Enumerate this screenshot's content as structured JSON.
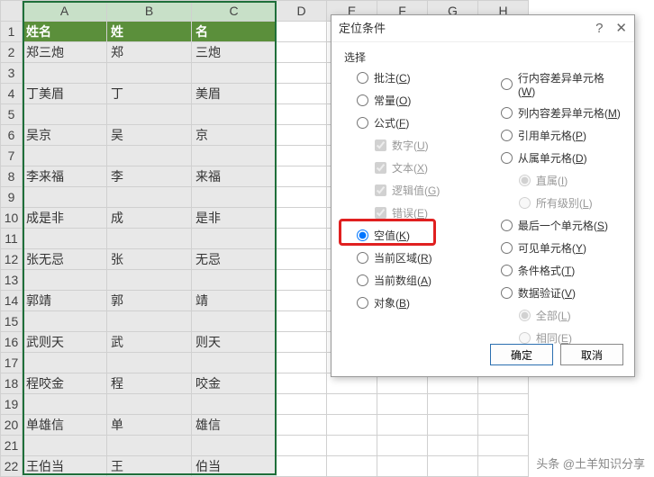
{
  "columns": [
    "A",
    "B",
    "C",
    "D",
    "E",
    "F",
    "G",
    "H"
  ],
  "rows_count": 22,
  "headers": {
    "A": "姓名",
    "B": "姓",
    "C": "名"
  },
  "data_rows": [
    {
      "A": "郑三炮",
      "B": "郑",
      "C": "三炮"
    },
    {
      "A": "",
      "B": "",
      "C": ""
    },
    {
      "A": "丁美眉",
      "B": "丁",
      "C": "美眉"
    },
    {
      "A": "",
      "B": "",
      "C": ""
    },
    {
      "A": "吴京",
      "B": "吴",
      "C": "京"
    },
    {
      "A": "",
      "B": "",
      "C": ""
    },
    {
      "A": "李来福",
      "B": "李",
      "C": "来福"
    },
    {
      "A": "",
      "B": "",
      "C": ""
    },
    {
      "A": "成是非",
      "B": "成",
      "C": "是非"
    },
    {
      "A": "",
      "B": "",
      "C": ""
    },
    {
      "A": "张无忌",
      "B": "张",
      "C": "无忌"
    },
    {
      "A": "",
      "B": "",
      "C": ""
    },
    {
      "A": "郭靖",
      "B": "郭",
      "C": "靖"
    },
    {
      "A": "",
      "B": "",
      "C": ""
    },
    {
      "A": "武则天",
      "B": "武",
      "C": "则天"
    },
    {
      "A": "",
      "B": "",
      "C": ""
    },
    {
      "A": "程咬金",
      "B": "程",
      "C": "咬金"
    },
    {
      "A": "",
      "B": "",
      "C": ""
    },
    {
      "A": "单雄信",
      "B": "单",
      "C": "雄信"
    },
    {
      "A": "",
      "B": "",
      "C": ""
    },
    {
      "A": "王伯当",
      "B": "王",
      "C": "伯当"
    }
  ],
  "dialog": {
    "title": "定位条件",
    "help": "?",
    "close": "✕",
    "section": "选择",
    "left_options": [
      {
        "type": "radio",
        "label": "批注(C)",
        "checked": false
      },
      {
        "type": "radio",
        "label": "常量(O)",
        "checked": false
      },
      {
        "type": "radio",
        "label": "公式(F)",
        "checked": false
      },
      {
        "type": "check",
        "label": "数字(U)",
        "sub": true,
        "checked": true,
        "disabled": true
      },
      {
        "type": "check",
        "label": "文本(X)",
        "sub": true,
        "checked": true,
        "disabled": true
      },
      {
        "type": "check",
        "label": "逻辑值(G)",
        "sub": true,
        "checked": true,
        "disabled": true
      },
      {
        "type": "check",
        "label": "错误(E)",
        "sub": true,
        "checked": true,
        "disabled": true
      },
      {
        "type": "radio",
        "label": "空值(K)",
        "checked": true
      },
      {
        "type": "radio",
        "label": "当前区域(R)",
        "checked": false
      },
      {
        "type": "radio",
        "label": "当前数组(A)",
        "checked": false
      },
      {
        "type": "radio",
        "label": "对象(B)",
        "checked": false
      }
    ],
    "right_options": [
      {
        "type": "radio",
        "label": "行内容差异单元格(W)",
        "checked": false
      },
      {
        "type": "radio",
        "label": "列内容差异单元格(M)",
        "checked": false
      },
      {
        "type": "radio",
        "label": "引用单元格(P)",
        "checked": false
      },
      {
        "type": "radio",
        "label": "从属单元格(D)",
        "checked": false
      },
      {
        "type": "radio",
        "label": "直属(I)",
        "sub": true,
        "checked": true,
        "disabled": true
      },
      {
        "type": "radio",
        "label": "所有级别(L)",
        "sub": true,
        "checked": false,
        "disabled": true
      },
      {
        "type": "radio",
        "label": "最后一个单元格(S)",
        "checked": false
      },
      {
        "type": "radio",
        "label": "可见单元格(Y)",
        "checked": false
      },
      {
        "type": "radio",
        "label": "条件格式(T)",
        "checked": false
      },
      {
        "type": "radio",
        "label": "数据验证(V)",
        "checked": false
      },
      {
        "type": "radio",
        "label": "全部(L)",
        "sub": true,
        "checked": true,
        "disabled": true
      },
      {
        "type": "radio",
        "label": "相同(E)",
        "sub": true,
        "checked": false,
        "disabled": true
      }
    ],
    "ok": "确定",
    "cancel": "取消"
  },
  "watermark": "头条 @土羊知识分享"
}
